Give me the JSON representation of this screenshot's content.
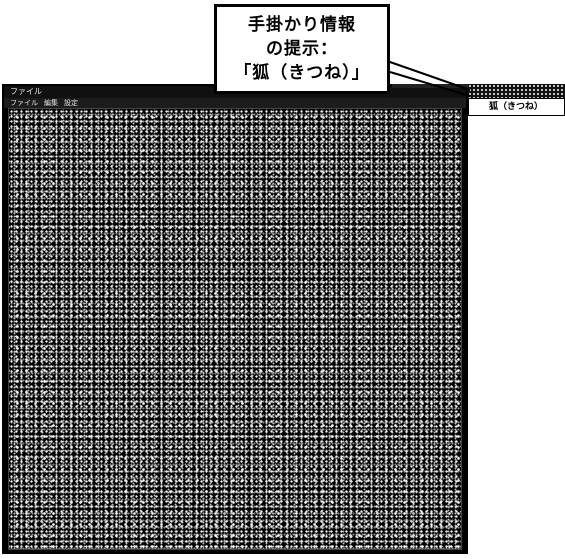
{
  "callout": {
    "line1": "手掛かり情報",
    "line2": "の提示：",
    "line3": "「狐（きつね）」"
  },
  "window": {
    "title": "ファイル",
    "menu": [
      "ファイル",
      "編集",
      "設定"
    ]
  },
  "hint_panel": {
    "text": "狐（きつね）"
  }
}
